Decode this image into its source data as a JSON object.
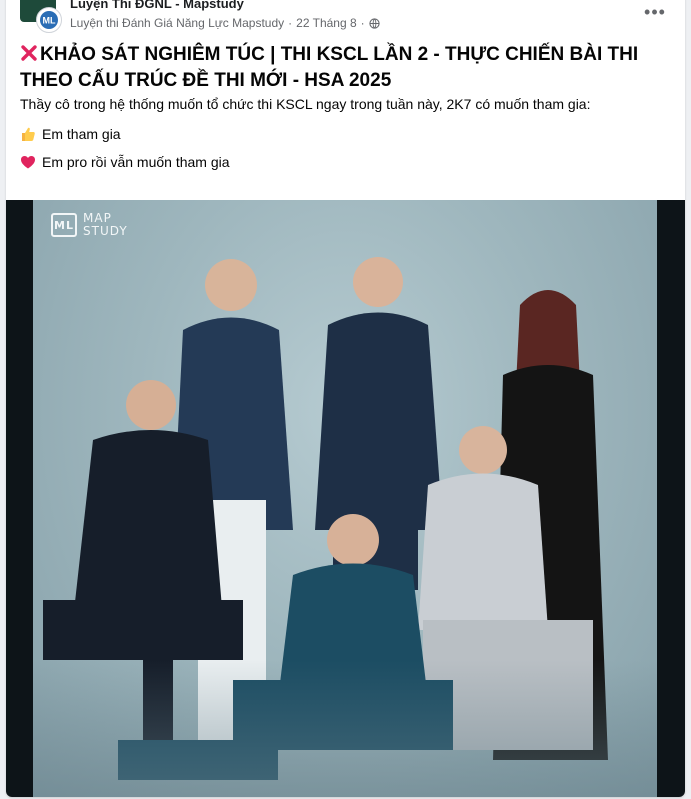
{
  "post": {
    "group_name": "Luyện Thi ĐGNL - Mapstudy",
    "author": "Luyện thi Đánh Giá Năng Lực Mapstudy",
    "separator": "·",
    "date": "22 Tháng 8",
    "visibility_icon": "globe-icon",
    "more_label": "•••",
    "title": "KHẢO SÁT NGHIÊM TÚC | THI KSCL LẦN 2 - THỰC CHIẾN BÀI THI THEO CẤU TRÚC ĐỀ THI MỚI - HSA 2025",
    "title_icon": "red-x-icon",
    "body": "Thầy cô trong hệ thống muốn tổ chức thi KSCL ngay trong tuần này, 2K7 có muốn tham gia:",
    "options": [
      {
        "icon": "thumbs-up-icon",
        "label": "Em tham gia"
      },
      {
        "icon": "red-heart-icon",
        "label": "Em pro rồi vẫn muốn tham gia"
      }
    ]
  },
  "photo": {
    "watermark_line1": "MAP",
    "watermark_line2": "STUDY",
    "watermark_mark": "ML"
  },
  "colors": {
    "accent_red": "#e0245e",
    "muted_text": "#65676b",
    "photo_background": "#9fb7be"
  }
}
